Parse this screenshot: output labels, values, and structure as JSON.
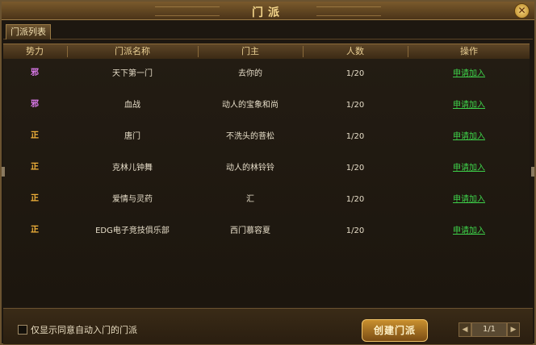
{
  "window": {
    "title": "门派"
  },
  "tabs": [
    {
      "label": "门派列表"
    }
  ],
  "columns": [
    "势力",
    "门派名称",
    "门主",
    "人数",
    "操作"
  ],
  "rows": [
    {
      "faction": "邪",
      "faction_type": "evil",
      "name": "天下第一门",
      "leader": "去你的",
      "members": "1/20",
      "action": "申请加入"
    },
    {
      "faction": "邪",
      "faction_type": "evil",
      "name": "血战",
      "leader": "动人的宝象和尚",
      "members": "1/20",
      "action": "申请加入"
    },
    {
      "faction": "正",
      "faction_type": "good",
      "name": "唐门",
      "leader": "不洗头的菩松",
      "members": "1/20",
      "action": "申请加入"
    },
    {
      "faction": "正",
      "faction_type": "good",
      "name": "克林儿钟舞",
      "leader": "动人的林铃铃",
      "members": "1/20",
      "action": "申请加入"
    },
    {
      "faction": "正",
      "faction_type": "good",
      "name": "爱情与灵药",
      "leader": "汇",
      "members": "1/20",
      "action": "申请加入"
    },
    {
      "faction": "正",
      "faction_type": "good",
      "name": "EDG电子竞技俱乐部",
      "leader": "西门慕容夏",
      "members": "1/20",
      "action": "申请加入"
    }
  ],
  "footer": {
    "checkbox_label": "仅显示同意自动入门的门派",
    "checkbox_checked": false,
    "create_button": "创建门派",
    "page": "1/1"
  },
  "colors": {
    "evil": "#e07cf0",
    "good": "#f2b23a",
    "link": "#3ed24a"
  }
}
